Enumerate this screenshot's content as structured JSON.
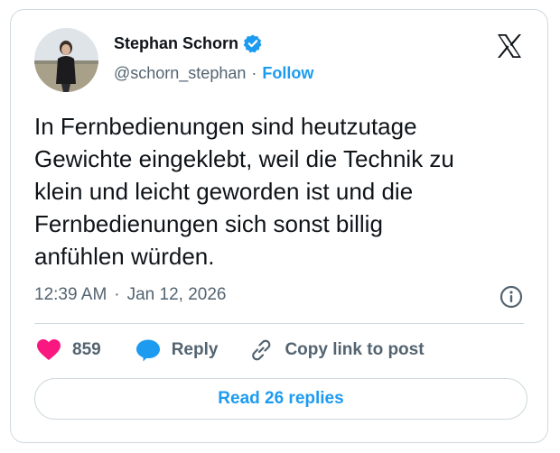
{
  "author": {
    "name": "Stephan Schorn",
    "handle": "@schorn_stephan",
    "separator": "·",
    "follow_label": "Follow",
    "verified_icon": "verified-badge-icon"
  },
  "tweet": {
    "text": "In Fernbedienungen sind heutzutage\nGewichte eingeklebt, weil die Technik zu\nklein und leicht geworden ist und die\nFernbedienungen sich sonst billig\nanfühlen würden.",
    "time": "12:39 AM",
    "separator": "·",
    "date": "Jan 12, 2026"
  },
  "actions": {
    "like_count": "859",
    "reply_label": "Reply",
    "copy_label": "Copy link to post"
  },
  "read_replies_label": "Read 26 replies",
  "colors": {
    "accent": "#1d9bf0",
    "like": "#f91880",
    "text": "#0f1419",
    "secondary": "#536471",
    "border": "#cfd9de"
  }
}
